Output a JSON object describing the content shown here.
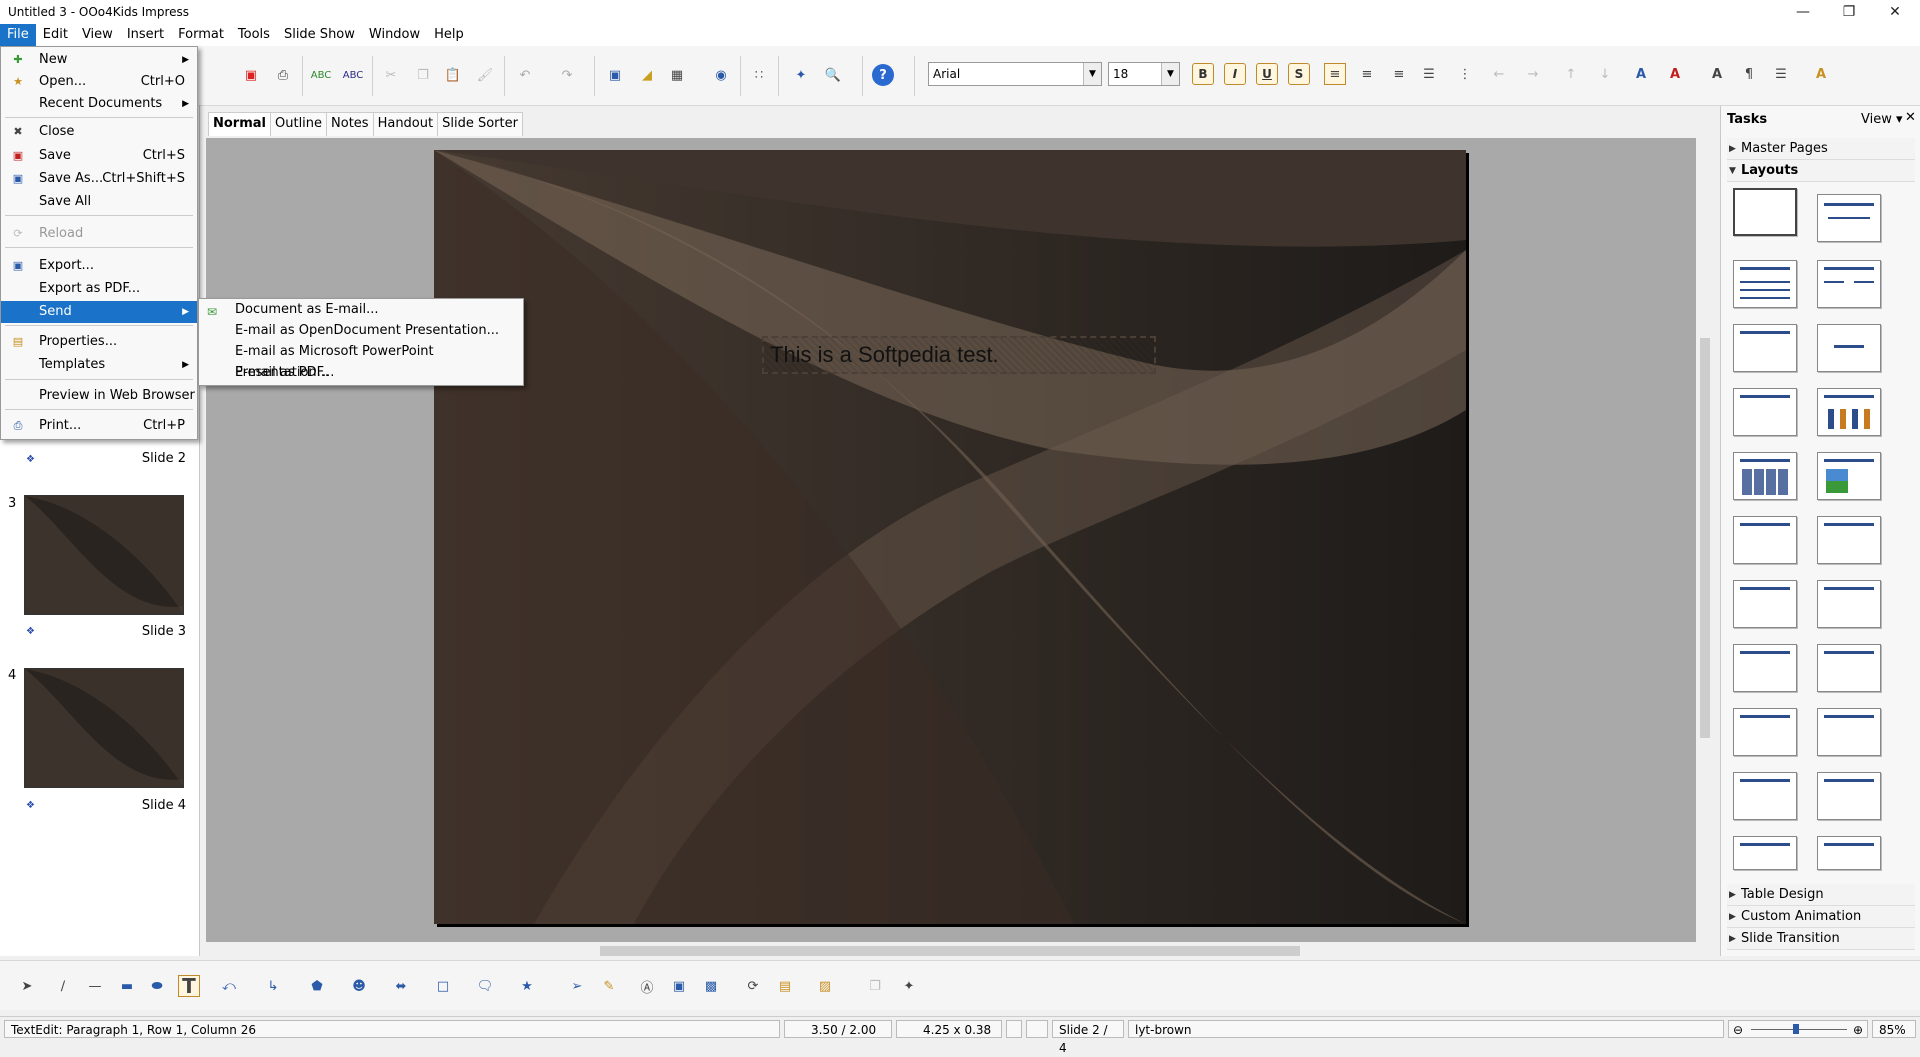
{
  "window": {
    "title": "Untitled 3 - OOo4Kids Impress"
  },
  "menubar": [
    "File",
    "Edit",
    "View",
    "Insert",
    "Format",
    "Tools",
    "Slide Show",
    "Window",
    "Help"
  ],
  "file_menu": {
    "items": [
      {
        "label": "New",
        "shortcut": "",
        "submenu": true,
        "icon": "new-document-icon"
      },
      {
        "label": "Open...",
        "shortcut": "Ctrl+O",
        "submenu": false,
        "icon": "open-folder-icon"
      },
      {
        "label": "Recent Documents",
        "shortcut": "",
        "submenu": true,
        "icon": ""
      },
      {
        "label": "Close",
        "shortcut": "",
        "submenu": false,
        "icon": "close-icon"
      },
      {
        "label": "Save",
        "shortcut": "Ctrl+S",
        "submenu": false,
        "icon": "save-icon"
      },
      {
        "label": "Save As...",
        "shortcut": "Ctrl+Shift+S",
        "submenu": false,
        "icon": "save-as-icon"
      },
      {
        "label": "Save All",
        "shortcut": "",
        "submenu": false,
        "icon": ""
      },
      {
        "label": "Reload",
        "shortcut": "",
        "submenu": false,
        "icon": "reload-icon"
      },
      {
        "label": "Export...",
        "shortcut": "",
        "submenu": false,
        "icon": "export-icon"
      },
      {
        "label": "Export as PDF...",
        "shortcut": "",
        "submenu": false,
        "icon": ""
      },
      {
        "label": "Send",
        "shortcut": "",
        "submenu": true,
        "icon": ""
      },
      {
        "label": "Properties...",
        "shortcut": "",
        "submenu": false,
        "icon": "properties-icon"
      },
      {
        "label": "Templates",
        "shortcut": "",
        "submenu": true,
        "icon": ""
      },
      {
        "label": "Preview in Web Browser",
        "shortcut": "",
        "submenu": false,
        "icon": ""
      },
      {
        "label": "Print...",
        "shortcut": "Ctrl+P",
        "submenu": false,
        "icon": "print-icon"
      }
    ]
  },
  "send_submenu": [
    "Document as E-mail...",
    "E-mail as OpenDocument Presentation...",
    "E-mail as Microsoft PowerPoint Presentation...",
    "E-mail as PDF..."
  ],
  "toolbar": {
    "font_name": "Arial",
    "font_size": "18",
    "bold": "B",
    "italic": "I",
    "underline": "U",
    "shadow": "S"
  },
  "view_tabs": [
    "Normal",
    "Outline",
    "Notes",
    "Handout",
    "Slide Sorter"
  ],
  "slides_pane": {
    "items": [
      {
        "num": "",
        "label": "Slide 2"
      },
      {
        "num": "3",
        "label": "Slide 3"
      },
      {
        "num": "4",
        "label": "Slide 4"
      }
    ]
  },
  "slide": {
    "text": "This is a Softpedia test."
  },
  "tasks": {
    "title": "Tasks",
    "view": "View",
    "sections_top": [
      "Master Pages",
      "Layouts"
    ],
    "sections_bottom": [
      "Table Design",
      "Custom Animation",
      "Slide Transition"
    ]
  },
  "status": {
    "edit": "TextEdit: Paragraph 1, Row 1, Column 26",
    "position": "3.50 / 2.00",
    "size": "4.25 x 0.38",
    "slide": "Slide 2 / 4",
    "master": "lyt-brown",
    "zoom": "85%"
  },
  "colors": {
    "accent": "#1a73c9",
    "slide_bg": "#3a302a"
  }
}
